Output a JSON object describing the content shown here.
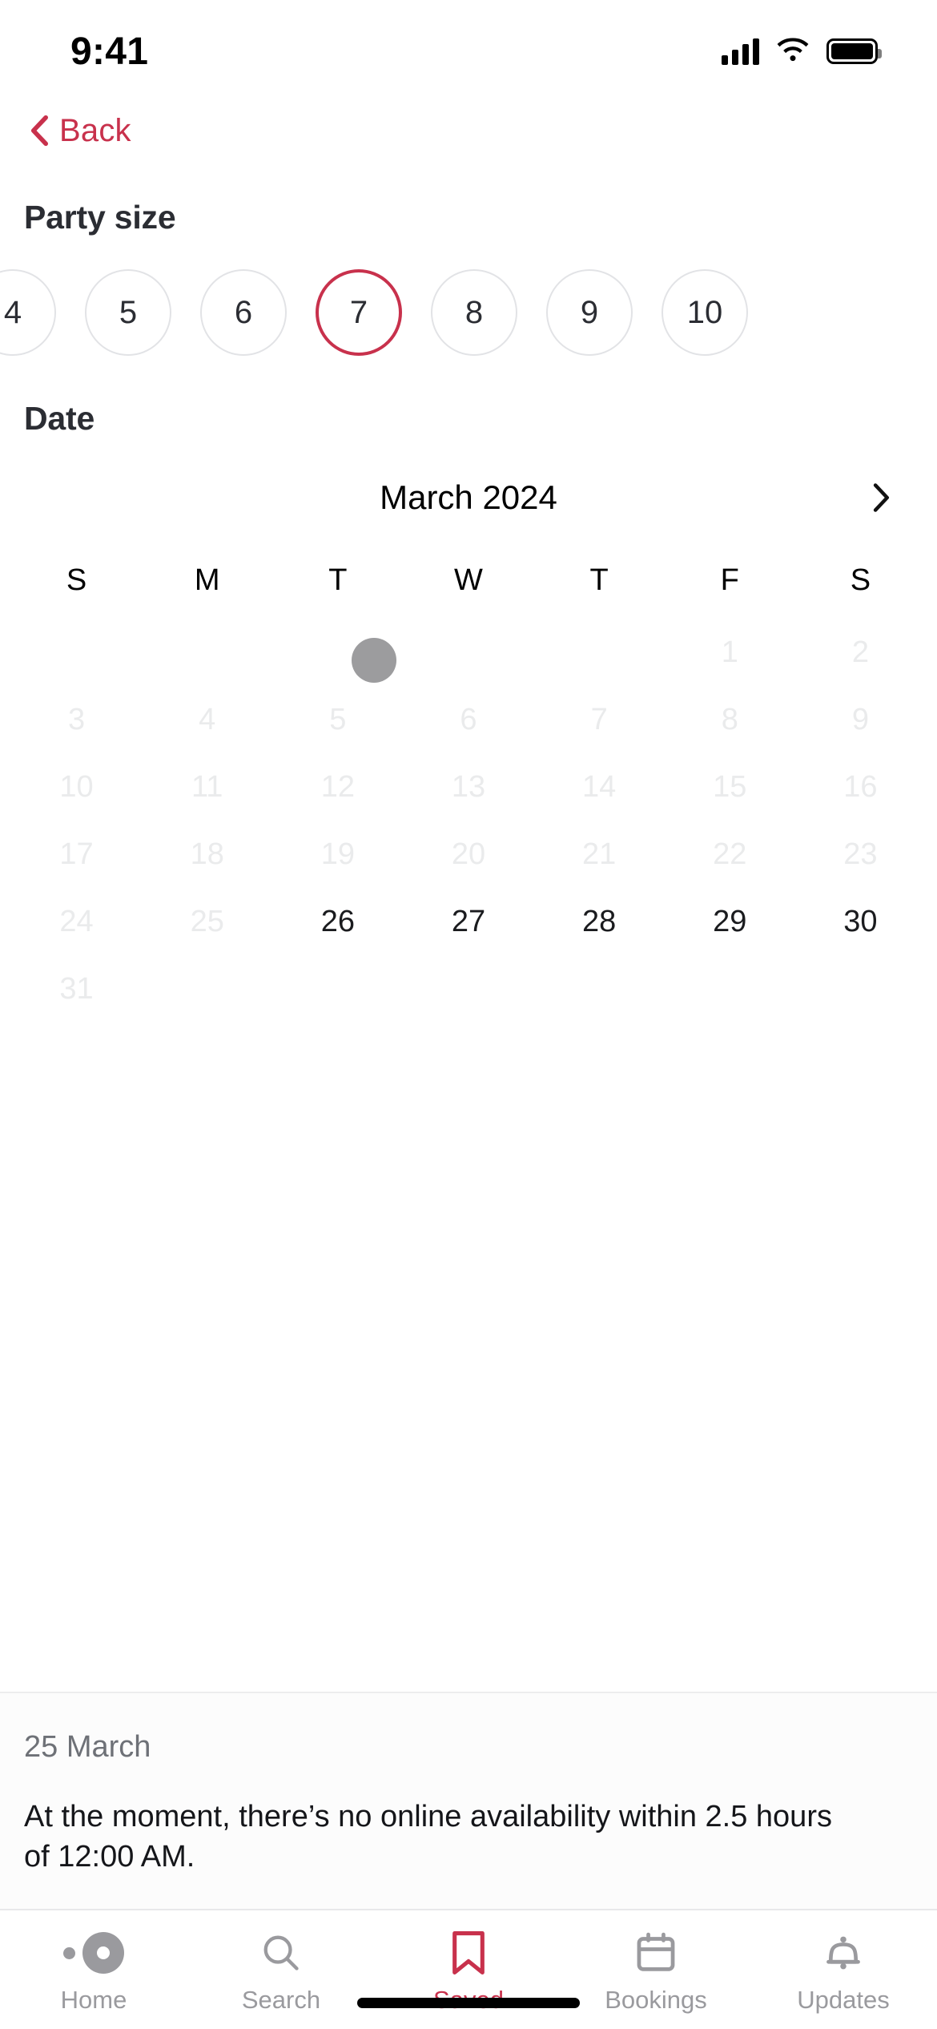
{
  "status_bar": {
    "time": "9:41",
    "signal_icon": "cellular-signal-icon",
    "wifi_icon": "wifi-icon",
    "battery_icon": "battery-full-icon"
  },
  "nav": {
    "back_label": "Back",
    "back_icon": "chevron-left-icon",
    "accent_color": "#C8314C"
  },
  "party_size": {
    "title": "Party size",
    "options": [
      "4",
      "5",
      "6",
      "7",
      "8",
      "9",
      "10"
    ],
    "selected": "7",
    "selected_border_color": "#C8314C",
    "unselected_border_color": "#E2E3E6"
  },
  "date_section": {
    "title": "Date",
    "month_label": "March 2024",
    "next_month_icon": "chevron-right-icon",
    "weekday_headers": [
      "S",
      "M",
      "T",
      "W",
      "T",
      "F",
      "S"
    ],
    "loading_indicator": "loading-dot-indicator",
    "weeks": [
      [
        {
          "label": "",
          "state": "empty"
        },
        {
          "label": "",
          "state": "empty"
        },
        {
          "label": "",
          "state": "empty"
        },
        {
          "label": "",
          "state": "empty"
        },
        {
          "label": "",
          "state": "empty"
        },
        {
          "label": "1",
          "state": "disabled"
        },
        {
          "label": "2",
          "state": "disabled"
        }
      ],
      [
        {
          "label": "3",
          "state": "disabled"
        },
        {
          "label": "4",
          "state": "disabled"
        },
        {
          "label": "5",
          "state": "disabled"
        },
        {
          "label": "6",
          "state": "disabled"
        },
        {
          "label": "7",
          "state": "disabled"
        },
        {
          "label": "8",
          "state": "disabled"
        },
        {
          "label": "9",
          "state": "disabled"
        }
      ],
      [
        {
          "label": "10",
          "state": "disabled"
        },
        {
          "label": "11",
          "state": "disabled"
        },
        {
          "label": "12",
          "state": "disabled"
        },
        {
          "label": "13",
          "state": "disabled"
        },
        {
          "label": "14",
          "state": "disabled"
        },
        {
          "label": "15",
          "state": "disabled"
        },
        {
          "label": "16",
          "state": "disabled"
        }
      ],
      [
        {
          "label": "17",
          "state": "disabled"
        },
        {
          "label": "18",
          "state": "disabled"
        },
        {
          "label": "19",
          "state": "disabled"
        },
        {
          "label": "20",
          "state": "disabled"
        },
        {
          "label": "21",
          "state": "disabled"
        },
        {
          "label": "22",
          "state": "disabled"
        },
        {
          "label": "23",
          "state": "disabled"
        }
      ],
      [
        {
          "label": "24",
          "state": "disabled"
        },
        {
          "label": "25",
          "state": "disabled"
        },
        {
          "label": "26",
          "state": "enabled"
        },
        {
          "label": "27",
          "state": "enabled"
        },
        {
          "label": "28",
          "state": "enabled"
        },
        {
          "label": "29",
          "state": "enabled"
        },
        {
          "label": "30",
          "state": "enabled"
        }
      ],
      [
        {
          "label": "31",
          "state": "disabled"
        },
        {
          "label": "",
          "state": "empty"
        },
        {
          "label": "",
          "state": "empty"
        },
        {
          "label": "",
          "state": "empty"
        },
        {
          "label": "",
          "state": "empty"
        },
        {
          "label": "",
          "state": "empty"
        },
        {
          "label": "",
          "state": "empty"
        }
      ]
    ]
  },
  "info_panel": {
    "date_label": "25 March",
    "message": "At the moment, there’s no online availability within 2.5 hours of 12:00 AM."
  },
  "tab_bar": {
    "active": "Saved",
    "active_color": "#C8314C",
    "inactive_color": "#9A9A9E",
    "tabs": [
      {
        "label": "Home",
        "icon": "opentable-home-icon"
      },
      {
        "label": "Search",
        "icon": "search-magnifier-icon"
      },
      {
        "label": "Saved",
        "icon": "bookmark-icon"
      },
      {
        "label": "Bookings",
        "icon": "calendar-icon"
      },
      {
        "label": "Updates",
        "icon": "bell-icon"
      }
    ]
  }
}
